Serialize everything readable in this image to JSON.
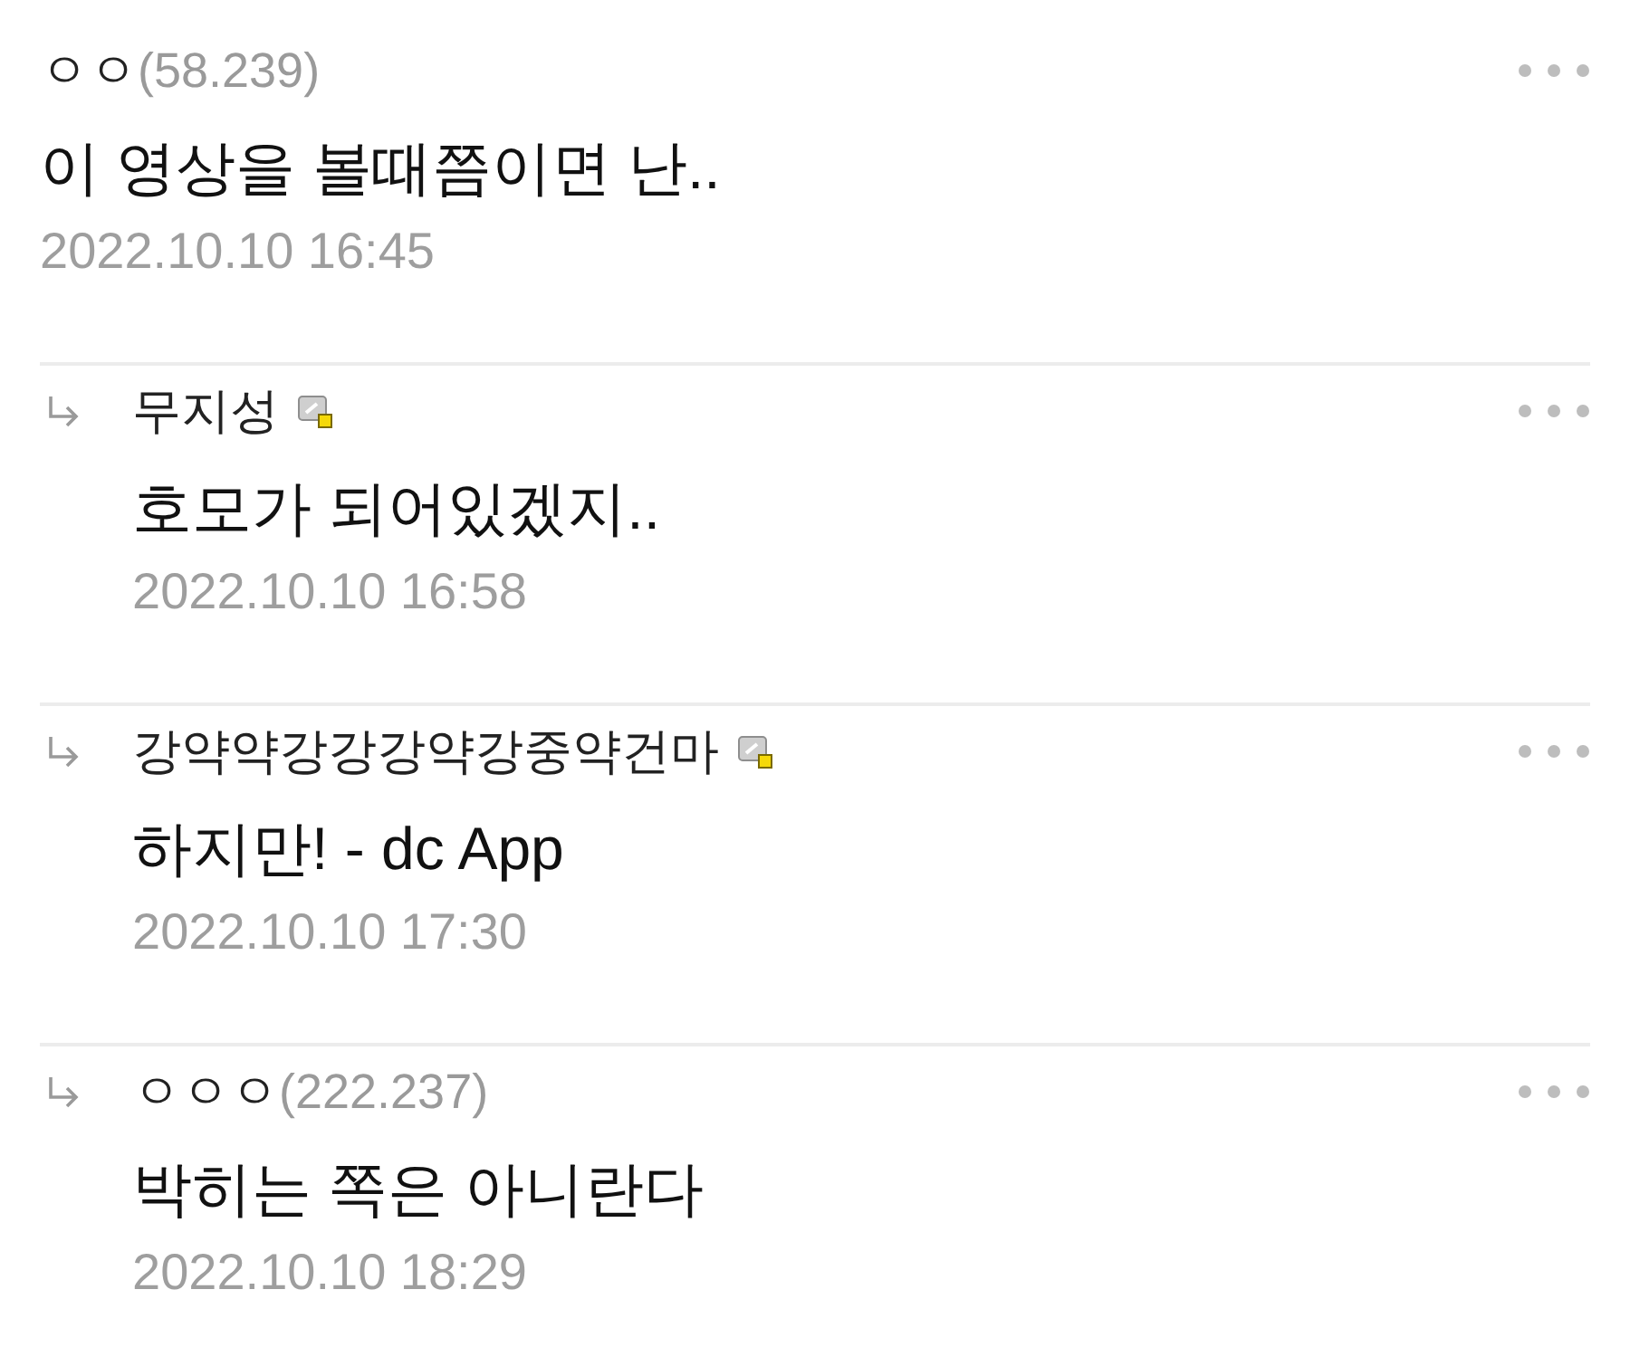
{
  "comments": [
    {
      "author": {
        "kind": "guest",
        "name": "ㅇㅇ",
        "ip": "(58.239)"
      },
      "body": "이 영상을 볼때쯤이면 난..",
      "date": "2022.10.10 16:45",
      "children": [
        {
          "author": {
            "kind": "member",
            "name": "무지성"
          },
          "body": "호모가 되어있겠지..",
          "date": "2022.10.10 16:58"
        },
        {
          "author": {
            "kind": "member",
            "name": "강약약강강강약강중약건마"
          },
          "body": "하지만! - dc App",
          "date": "2022.10.10 17:30"
        },
        {
          "author": {
            "kind": "guest",
            "name": "ㅇㅇㅇ",
            "ip": "(222.237)"
          },
          "body": "박히는 쪽은 아니란다",
          "date": "2022.10.10 18:29"
        }
      ]
    }
  ]
}
